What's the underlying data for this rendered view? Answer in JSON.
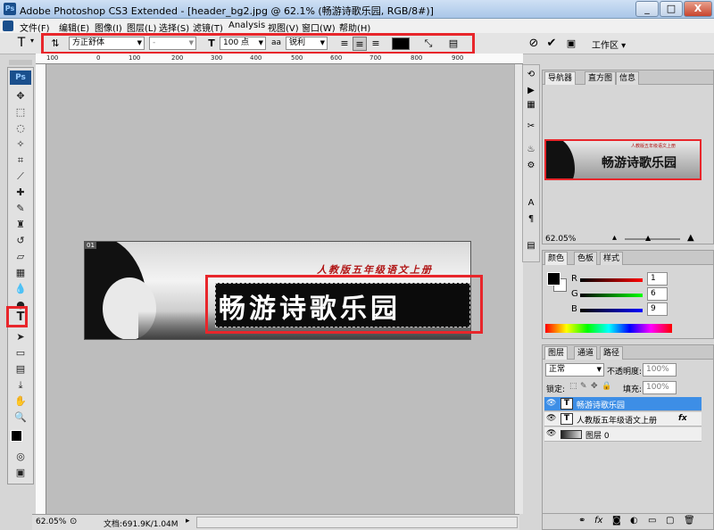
{
  "window": {
    "title": "Adobe Photoshop CS3 Extended - [header_bg2.jpg @ 62.1% (畅游诗歌乐园, RGB/8#)]",
    "minimize": "_",
    "maximize": "□",
    "close": "X"
  },
  "menu": [
    "文件(F)",
    "编辑(E)",
    "图像(I)",
    "图层(L)",
    "选择(S)",
    "滤镜(T)",
    "Analysis",
    "视图(V)",
    "窗口(W)",
    "帮助(H)"
  ],
  "options": {
    "tool_glyph": "T",
    "font_family": "方正舒体",
    "font_style": "-",
    "font_size": "100 点",
    "aa_icon": "aa",
    "antialias": "锐利",
    "workspace": "工作区 ▾"
  },
  "ruler_ticks": [
    "100",
    "0",
    "100",
    "200",
    "300",
    "400",
    "500",
    "600",
    "700",
    "800",
    "900"
  ],
  "toolbox": {
    "logo": "Ps"
  },
  "canvas": {
    "badge": "01",
    "subtitle": "人教版五年级语文上册",
    "title": "畅游诗歌乐园"
  },
  "status": {
    "zoom": "62.05%",
    "doc": "文档:691.9K/1.04M"
  },
  "navigator": {
    "tabs": [
      "导航器",
      "直方图",
      "信息"
    ],
    "zoom": "62.05%",
    "subtitle": "人教版五年级语文上册",
    "title": "畅游诗歌乐园"
  },
  "color": {
    "tabs": [
      "颜色",
      "色板",
      "样式"
    ],
    "r_label": "R",
    "g_label": "G",
    "b_label": "B",
    "r": "1",
    "g": "6",
    "b": "9"
  },
  "layers": {
    "tabs": [
      "图层",
      "通道",
      "路径"
    ],
    "blend_mode": "正常",
    "opacity_label": "不透明度:",
    "opacity": "100%",
    "lock_label": "锁定:",
    "fill_label": "填充:",
    "fill": "100%",
    "items": [
      {
        "name": "畅游诗歌乐园",
        "type": "T",
        "fx": ""
      },
      {
        "name": "人教版五年级语文上册",
        "type": "T",
        "fx": "fx"
      },
      {
        "name": "图层 0",
        "type": "",
        "fx": ""
      }
    ]
  },
  "colors": {
    "highlight": "#e8262b",
    "selection": "#3d8ee6",
    "title_text": "#ffffff",
    "subtitle_text": "#b01515"
  }
}
